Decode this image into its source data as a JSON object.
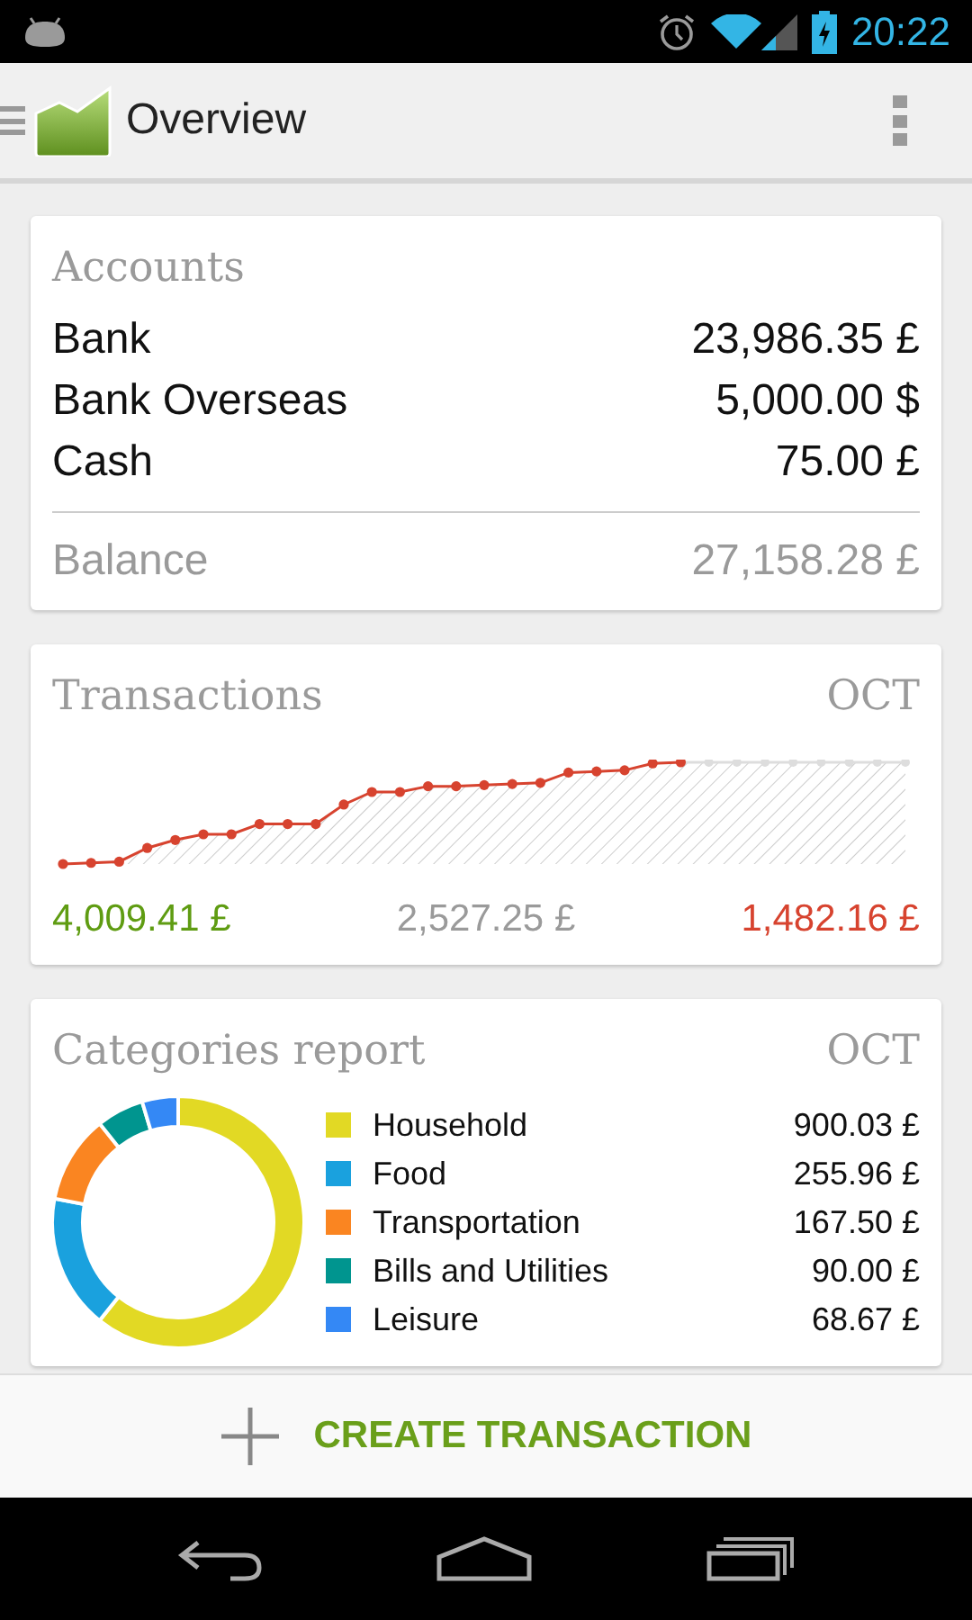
{
  "status_bar": {
    "time": "20:22"
  },
  "app_bar": {
    "title": "Overview"
  },
  "accounts": {
    "title": "Accounts",
    "rows": [
      {
        "name": "Bank",
        "amount": "23,986.35 £"
      },
      {
        "name": "Bank Overseas",
        "amount": "5,000.00 $"
      },
      {
        "name": "Cash",
        "amount": "75.00 £"
      }
    ],
    "balance": {
      "label": "Balance",
      "amount": "27,158.28 £"
    }
  },
  "transactions": {
    "title": "Transactions",
    "month": "OCT",
    "totals": [
      {
        "kind": "income",
        "value": "4,009.41 £"
      },
      {
        "kind": "net",
        "value": "2,527.25 £"
      },
      {
        "kind": "expense",
        "value": "1,482.16 £"
      }
    ]
  },
  "categories": {
    "title": "Categories report",
    "month": "OCT",
    "chart_data": {
      "type": "donut",
      "categories": [
        "Household",
        "Food",
        "Transportation",
        "Bills and Utilities",
        "Leisure"
      ],
      "values": [
        60.73,
        17.27,
        11.3,
        6.07,
        4.63
      ]
    },
    "legend": [
      {
        "amount": "900.03 £",
        "color": "#e2d924"
      },
      {
        "amount": "255.96 £",
        "color": "#1aa1de"
      },
      {
        "amount": "167.50 £",
        "color": "#fa8521"
      },
      {
        "amount": "90.00 £",
        "color": "#00958f"
      },
      {
        "amount": "68.67 £",
        "color": "#3488f5"
      }
    ]
  },
  "action": {
    "label": "CREATE TRANSACTION"
  }
}
